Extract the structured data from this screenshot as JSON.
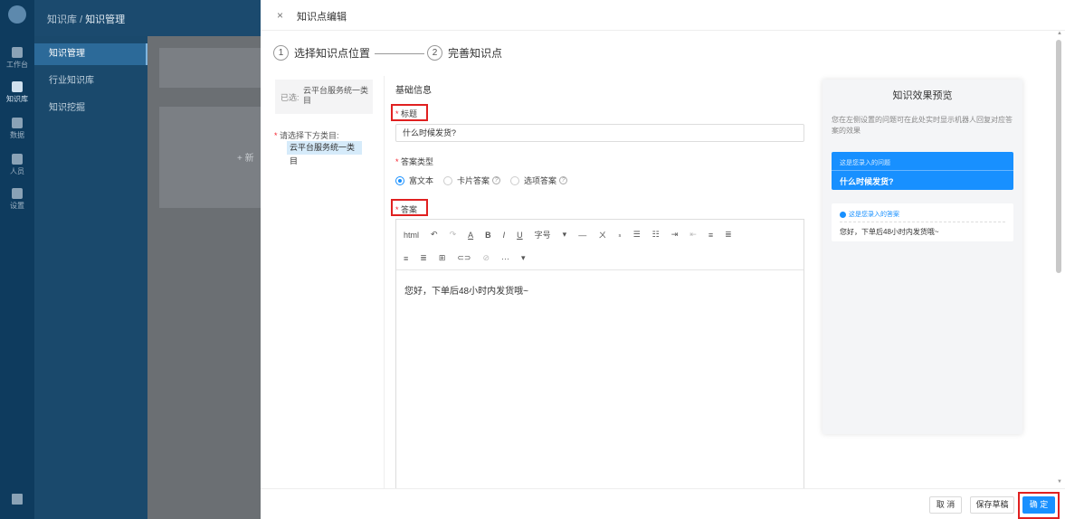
{
  "app": {
    "rail": [
      {
        "label": "工作台"
      },
      {
        "label": "知识库"
      },
      {
        "label": "数据"
      },
      {
        "label": "人员"
      },
      {
        "label": "设置"
      }
    ],
    "breadcrumb": {
      "root": "知识库",
      "sep": "/",
      "current": "知识管理"
    },
    "menu": [
      "知识管理",
      "行业知识库",
      "知识挖掘"
    ],
    "bg_add": "+ 新"
  },
  "drawer": {
    "close_icon": "×",
    "title": "知识点编辑",
    "steps": [
      {
        "num": "1",
        "label": "选择知识点位置"
      },
      {
        "num": "2",
        "label": "完善知识点"
      }
    ],
    "selected_prefix": "已选:",
    "selected_value": "云平台服务统一类目",
    "category_label": "请选择下方类目:",
    "category_item": "云平台服务统一类目",
    "section_title": "基础信息",
    "title_label": "标题",
    "title_value": "什么时候发货?",
    "answer_type_label": "答案类型",
    "answer_types": [
      "富文本",
      "卡片答案",
      "选项答案"
    ],
    "answer_label": "答案",
    "toolbar_row1": [
      "html",
      "↶",
      "↷",
      "A",
      "B",
      "I",
      "U",
      "字号",
      "▾",
      "—",
      "ㄨ",
      "ₛ",
      "☰",
      "☷",
      "⇥",
      "⇤",
      "≡",
      "≣"
    ],
    "toolbar_row2": [
      "≡",
      "≣",
      "⊞",
      "⊂⊃",
      "⊘",
      "···",
      "▾"
    ],
    "answer_content": "您好，下单后48小时内发货哦~",
    "preview": {
      "title": "知识效果预览",
      "desc": "您在左侧设置的问题可在此处实时显示机器人回复对应答案的效果",
      "question_hint": "这是您录入的问题",
      "question": "什么时候发货?",
      "answer_hint": "这是您录入的答案",
      "answer": "您好，下单后48小时内发货哦~"
    },
    "buttons": {
      "cancel": "取 消",
      "draft": "保存草稿",
      "confirm": "确 定"
    },
    "colors": {
      "primary": "#1890ff",
      "highlight": "#e02020"
    }
  }
}
